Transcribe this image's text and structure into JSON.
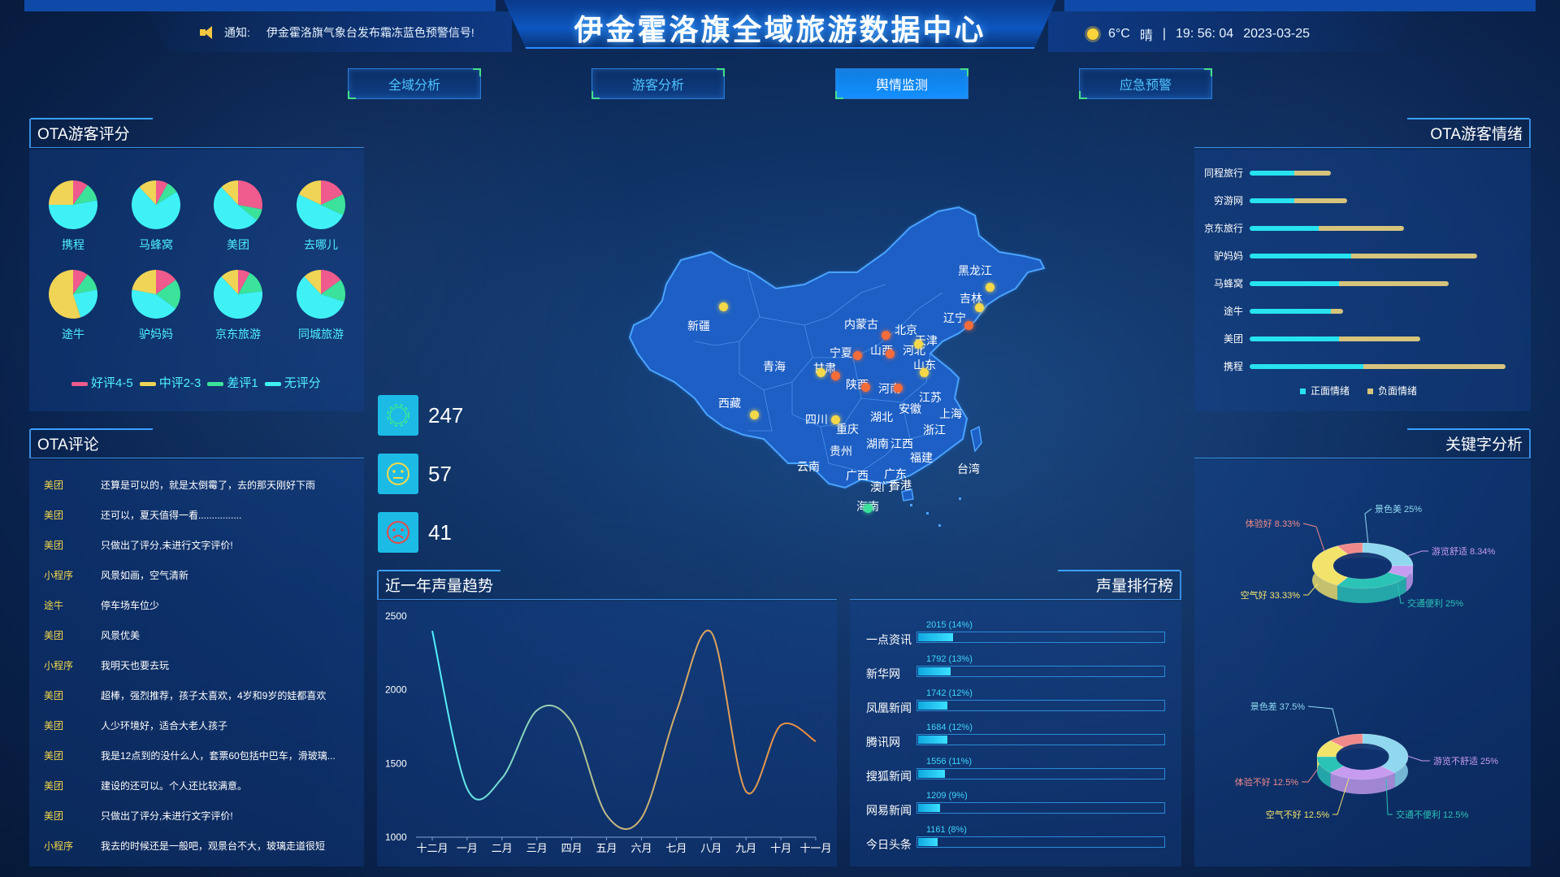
{
  "header": {
    "title": "伊金霍洛旗全域旅游数据中心",
    "notice_label": "通知:",
    "notice_text": "伊金霍洛旗气象台发布霜冻蓝色预警信号!",
    "temperature": "6°C",
    "weather": "晴",
    "separator": "|",
    "time": "19: 56: 04",
    "date": "2023-03-25"
  },
  "tabs": [
    {
      "label": "全域分析",
      "active": false
    },
    {
      "label": "游客分析",
      "active": false
    },
    {
      "label": "舆情监测",
      "active": true
    },
    {
      "label": "应急预警",
      "active": false
    }
  ],
  "ota_score": {
    "title": "OTA游客评分",
    "colors": {
      "good": "#ef5b8c",
      "mid": "#f0d456",
      "bad": "#3be39a",
      "none": "#3ff1f5"
    },
    "platforms": [
      {
        "name": "携程",
        "good": 10,
        "mid": 25,
        "bad": 12,
        "none": 53
      },
      {
        "name": "马蜂窝",
        "good": 8,
        "mid": 12,
        "bad": 8,
        "none": 72
      },
      {
        "name": "美团",
        "good": 28,
        "mid": 12,
        "bad": 8,
        "none": 52
      },
      {
        "name": "去哪儿",
        "good": 18,
        "mid": 18,
        "bad": 14,
        "none": 50
      },
      {
        "name": "途牛",
        "good": 10,
        "mid": 55,
        "bad": 12,
        "none": 23
      },
      {
        "name": "驴妈妈",
        "good": 15,
        "mid": 22,
        "bad": 20,
        "none": 43
      },
      {
        "name": "京东旅游",
        "good": 8,
        "mid": 12,
        "bad": 15,
        "none": 65
      },
      {
        "name": "同城旅游",
        "good": 15,
        "mid": 12,
        "bad": 15,
        "none": 58
      }
    ],
    "legend": [
      "好评4-5",
      "中评2-3",
      "差评1",
      "无评分"
    ]
  },
  "ota_comments": {
    "title": "OTA评论",
    "items": [
      {
        "source": "美团",
        "text": "还算是可以的，就是太倒霉了，去的那天刚好下雨"
      },
      {
        "source": "美团",
        "text": "还可以，夏天值得一看................"
      },
      {
        "source": "美团",
        "text": "只做出了评分,未进行文字评价!"
      },
      {
        "source": "小程序",
        "text": "风景如画，空气清新"
      },
      {
        "source": "途牛",
        "text": "停车场车位少"
      },
      {
        "source": "美团",
        "text": "风景优美"
      },
      {
        "source": "小程序",
        "text": "我明天也要去玩"
      },
      {
        "source": "美团",
        "text": "超棒，强烈推荐，孩子太喜欢，4岁和9岁的娃都喜欢"
      },
      {
        "source": "美团",
        "text": "人少环境好，适合大老人孩子"
      },
      {
        "source": "美团",
        "text": "我是12点到的没什么人，套票60包括中巴车，滑玻璃..."
      },
      {
        "source": "美团",
        "text": "建设的还可以。个人还比较满意。"
      },
      {
        "source": "美团",
        "text": "只做出了评分,未进行文字评价!"
      },
      {
        "source": "小程序",
        "text": "我去的时候还是一般吧，观景台不大，玻璃走道很短"
      }
    ]
  },
  "sentiment": {
    "positive": "247",
    "neutral": "57",
    "negative": "41"
  },
  "map": {
    "regions": [
      "黑龙江",
      "吉林",
      "辽宁",
      "内蒙古",
      "北京",
      "天津",
      "河北",
      "山西",
      "山东",
      "宁夏",
      "甘肃",
      "青海",
      "新疆",
      "西藏",
      "陕西",
      "河南",
      "江苏",
      "安徽",
      "上海",
      "湖北",
      "四川",
      "重庆",
      "浙江",
      "湖南",
      "江西",
      "福建",
      "贵州",
      "云南",
      "广西",
      "广东",
      "台湾",
      "澳门",
      "香港",
      "海南"
    ]
  },
  "ota_emotion": {
    "title": "OTA游客情绪",
    "legend": [
      "正面情绪",
      "负面情绪"
    ],
    "rows": [
      {
        "name": "同程旅行",
        "pos": 55,
        "neg": 45
      },
      {
        "name": "穷游网",
        "pos": 55,
        "neg": 65
      },
      {
        "name": "京东旅行",
        "pos": 85,
        "neg": 105
      },
      {
        "name": "驴妈妈",
        "pos": 125,
        "neg": 155
      },
      {
        "name": "马蜂窝",
        "pos": 110,
        "neg": 135
      },
      {
        "name": "途牛",
        "pos": 100,
        "neg": 15
      },
      {
        "name": "美团",
        "pos": 110,
        "neg": 100
      },
      {
        "name": "携程",
        "pos": 140,
        "neg": 175
      }
    ]
  },
  "keywords": {
    "title": "关键字分析",
    "positive": [
      {
        "label": "景色美 25%",
        "value": 25,
        "color": "#8fd8f0"
      },
      {
        "label": "游览舒适 8.34%",
        "value": 8.34,
        "color": "#c79cf0"
      },
      {
        "label": "交通便利 25%",
        "value": 25,
        "color": "#2bc3b6"
      },
      {
        "label": "空气好 33.33%",
        "value": 33.33,
        "color": "#f2e36b"
      },
      {
        "label": "体验好 8.33%",
        "value": 8.33,
        "color": "#f08a8a"
      }
    ],
    "negative": [
      {
        "label": "景色差 37.5%",
        "value": 37.5,
        "color": "#8fd8f0"
      },
      {
        "label": "游览不舒适 25%",
        "value": 25,
        "color": "#c79cf0"
      },
      {
        "label": "交通不便利 12.5%",
        "value": 12.5,
        "color": "#2bc3b6"
      },
      {
        "label": "空气不好 12.5%",
        "value": 12.5,
        "color": "#f2e36b"
      },
      {
        "label": "体验不好 12.5%",
        "value": 12.5,
        "color": "#f08a8a"
      }
    ]
  },
  "trend": {
    "title": "近一年声量趋势",
    "chart_data": {
      "type": "line",
      "categories": [
        "十二月",
        "一月",
        "二月",
        "三月",
        "四月",
        "五月",
        "六月",
        "七月",
        "八月",
        "九月",
        "十月",
        "十一月"
      ],
      "values": [
        2400,
        1330,
        1400,
        1860,
        1780,
        1150,
        1130,
        1850,
        2390,
        1310,
        1760,
        1650
      ],
      "ylim": [
        1000,
        2500
      ],
      "yticks": [
        "2500",
        "2000",
        "1500",
        "1000"
      ]
    }
  },
  "ranking": {
    "title": "声量排行榜",
    "rows": [
      {
        "name": "一点资讯",
        "label": "2015 (14%)",
        "pct": 14
      },
      {
        "name": "新华网",
        "label": "1792 (13%)",
        "pct": 13
      },
      {
        "name": "凤凰新闻",
        "label": "1742 (12%)",
        "pct": 12
      },
      {
        "name": "腾讯网",
        "label": "1684 (12%)",
        "pct": 12
      },
      {
        "name": "搜狐新闻",
        "label": "1556 (11%)",
        "pct": 11
      },
      {
        "name": "网易新闻",
        "label": "1209 (9%)",
        "pct": 9
      },
      {
        "name": "今日头条",
        "label": "1161 (8%)",
        "pct": 8
      }
    ]
  }
}
